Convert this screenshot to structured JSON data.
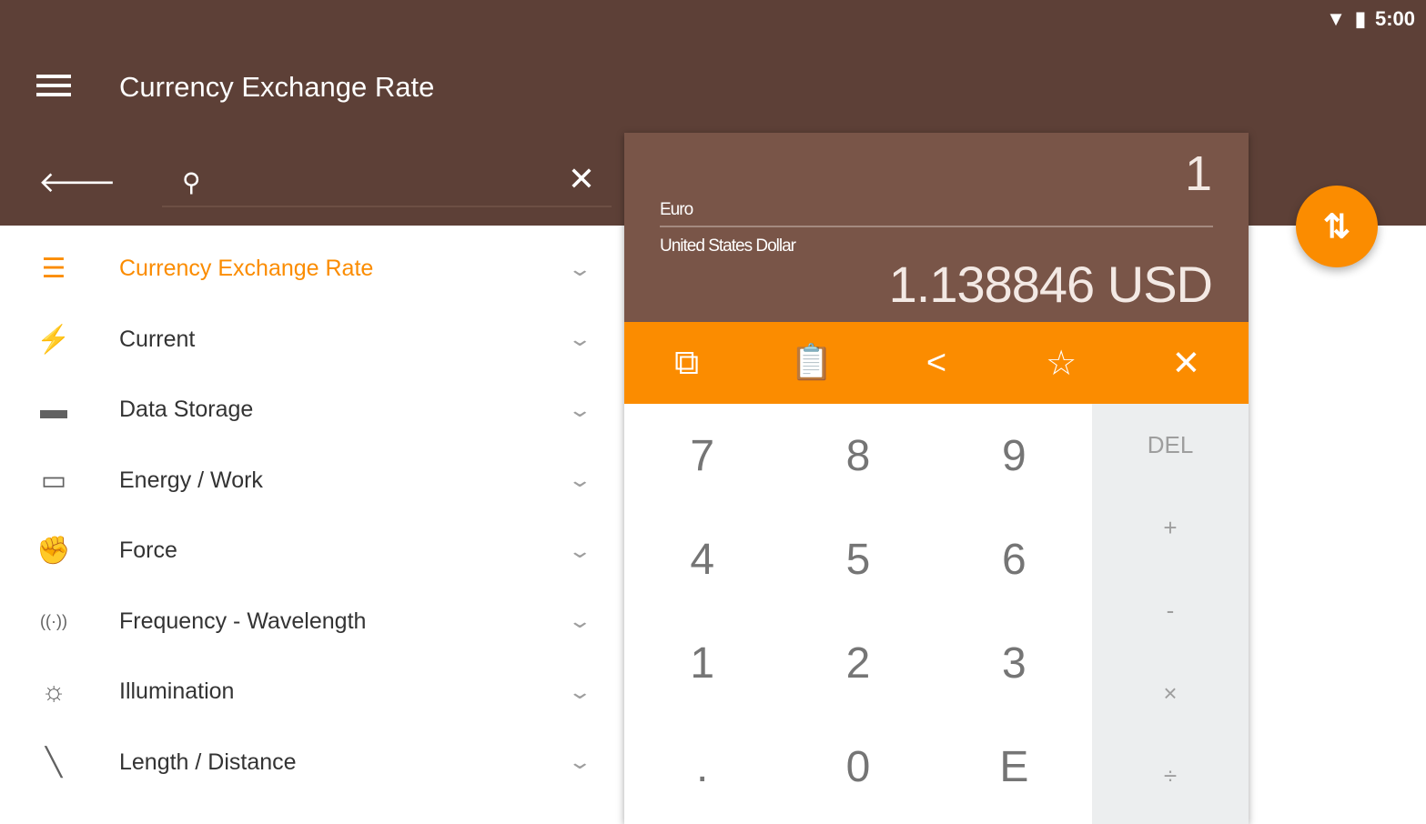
{
  "status": {
    "time": "5:00",
    "wifi_icon": "wifi-icon",
    "battery_icon": "battery-icon"
  },
  "header": {
    "title": "Currency Exchange Rate"
  },
  "search": {
    "value": "",
    "placeholder": ""
  },
  "categories": [
    {
      "label": "Currency Exchange Rate",
      "icon": "coins-icon",
      "glyph": "☰",
      "active": true
    },
    {
      "label": "Current",
      "icon": "lightning-icon",
      "glyph": "⚡"
    },
    {
      "label": "Data Storage",
      "icon": "hard-drive-icon",
      "glyph": "▬"
    },
    {
      "label": "Energy / Work",
      "icon": "battery-icon",
      "glyph": "▭"
    },
    {
      "label": "Force",
      "icon": "fist-icon",
      "glyph": "✊"
    },
    {
      "label": "Frequency - Wavelength",
      "icon": "antenna-icon",
      "glyph": "((·))"
    },
    {
      "label": "Illumination",
      "icon": "sun-icon",
      "glyph": "☼"
    },
    {
      "label": "Length / Distance",
      "icon": "ruler-icon",
      "glyph": "╲"
    }
  ],
  "converter": {
    "input_value": "1",
    "from_unit": "Euro",
    "to_unit": "United States Dollar",
    "result": "1.138846 USD"
  },
  "toolbar": [
    "⧉",
    "📋",
    "<",
    "☆",
    "✕"
  ],
  "keypad": {
    "digits": [
      "7",
      "8",
      "9",
      "4",
      "5",
      "6",
      "1",
      "2",
      "3",
      ".",
      "0",
      "E"
    ],
    "ops": [
      "DEL",
      "+",
      "-",
      "×",
      "÷"
    ]
  },
  "colors": {
    "appbar": "#5d4037",
    "card": "#795548",
    "accent": "#fb8c00"
  }
}
